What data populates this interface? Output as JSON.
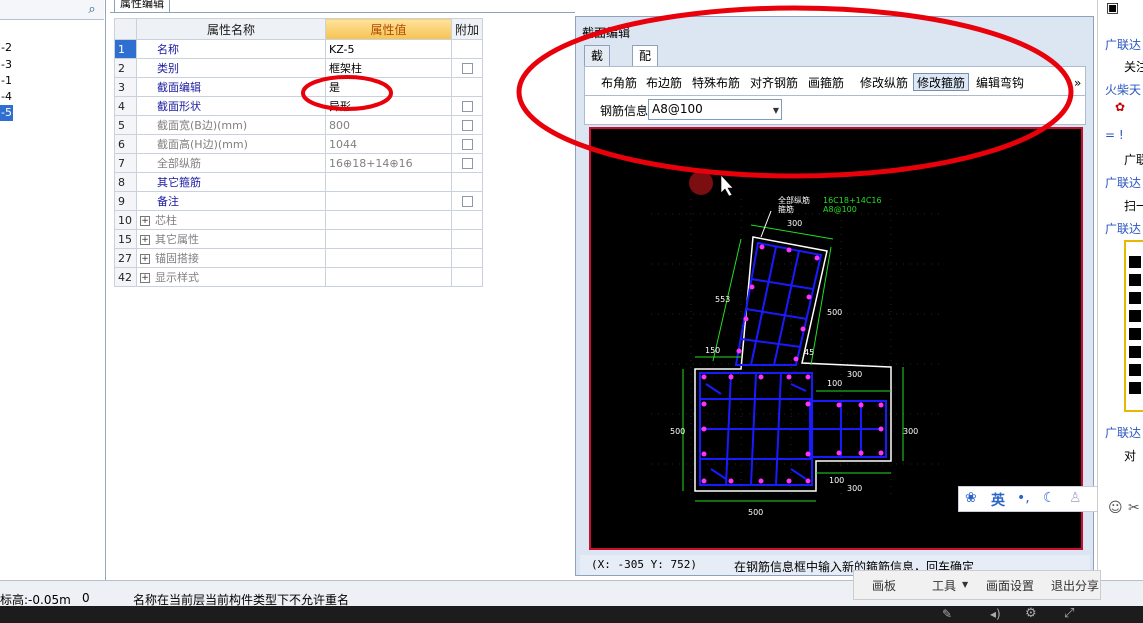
{
  "tree": {
    "items": [
      "-2",
      "-3",
      "-1",
      "-4",
      "-5"
    ]
  },
  "property_editor": {
    "tab_label": "属性编辑",
    "headers": {
      "name": "属性名称",
      "value": "属性值",
      "extra": "附加"
    },
    "rows": [
      {
        "no": "1",
        "name": "名称",
        "value": "KZ-5"
      },
      {
        "no": "2",
        "name": "类别",
        "value": "框架柱"
      },
      {
        "no": "3",
        "name": "截面编辑",
        "value": "是"
      },
      {
        "no": "4",
        "name": "截面形状",
        "value": "异形"
      },
      {
        "no": "5",
        "name": "截面宽(B边)(mm)",
        "value": "800"
      },
      {
        "no": "6",
        "name": "截面高(H边)(mm)",
        "value": "1044"
      },
      {
        "no": "7",
        "name": "全部纵筋",
        "value": "16⊕18+14⊕16"
      },
      {
        "no": "8",
        "name": "其它箍筋",
        "value": ""
      },
      {
        "no": "9",
        "name": "备注",
        "value": ""
      },
      {
        "no": "10",
        "name": "芯柱",
        "value": ""
      },
      {
        "no": "15",
        "name": "其它属性",
        "value": ""
      },
      {
        "no": "27",
        "name": "锚固搭接",
        "value": ""
      },
      {
        "no": "42",
        "name": "显示样式",
        "value": ""
      }
    ]
  },
  "section_editor": {
    "title": "截面编辑",
    "tabs": [
      "截面",
      "配筋"
    ],
    "toolbar": [
      "布角筋",
      "布边筋",
      "特殊布筋",
      "对齐钢筋",
      "画箍筋",
      "修改纵筋",
      "修改箍筋",
      "编辑弯钩"
    ],
    "rebar_info_label": "钢筋信息",
    "rebar_info_value": "A8@100",
    "drawing": {
      "label_all_long": "全部纵筋",
      "label_stirrup": "箍筋",
      "value_all_long": "16C18+14C16",
      "value_stirrup": "A8@100",
      "dims": [
        "300",
        "553",
        "500",
        "150",
        "45",
        "100",
        "300",
        "500",
        "300",
        "100",
        "300",
        "500"
      ]
    },
    "coords": "(X: -305 Y: 752)",
    "hint": "在钢筋信息框中输入新的箍筋信息，回车确定"
  },
  "chat": {
    "lines": [
      "广联达",
      "关注",
      "火柴天",
      "= !",
      "广联",
      "广联达",
      "扫一",
      "广联达",
      "广联达",
      "对"
    ]
  },
  "status_bar": {
    "elevation": "标高:-0.05m",
    "count": "0",
    "message": "名称在当前层当前构件类型下不允许重名"
  },
  "share_bar": {
    "items": [
      "画板",
      "工具",
      "画面设置",
      "退出分享"
    ]
  },
  "ime": {
    "lang": "英"
  },
  "colors": {
    "annotation_red": "#e8000b",
    "selection_blue": "#2f6fcf",
    "rebar_blue": "#1a1aff",
    "dim_green": "#22dd22"
  }
}
